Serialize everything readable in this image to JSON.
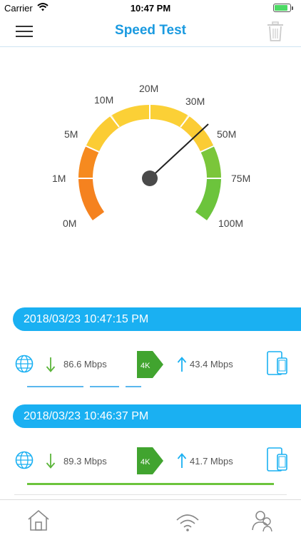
{
  "status_bar": {
    "carrier": "Carrier",
    "time": "10:47 PM",
    "wifi_icon": "wifi-icon",
    "battery_icon": "battery-icon"
  },
  "nav": {
    "title": "Speed Test",
    "menu_icon": "hamburger-icon",
    "trash_icon": "trash-icon"
  },
  "gauge": {
    "labels": [
      "0M",
      "1M",
      "5M",
      "10M",
      "20M",
      "30M",
      "50M",
      "75M",
      "100M"
    ],
    "needle_value": "50M"
  },
  "records": [
    {
      "timestamp": "2018/03/23 10:47:15 PM",
      "download": "86.6 Mbps",
      "upload": "43.4 Mbps",
      "badge": "4K"
    },
    {
      "timestamp": "2018/03/23 10:46:37 PM",
      "download": "89.3 Mbps",
      "upload": "41.7 Mbps",
      "badge": "4K"
    }
  ],
  "colors": {
    "accent": "#1ab0f2",
    "title": "#1a9ae0",
    "orange": "#f5821f",
    "yellow": "#fbd036",
    "green": "#6cc43c",
    "badge_green": "#41a42f"
  },
  "tabs": [
    {
      "icon": "home-icon"
    },
    {
      "icon": "speedometer-icon"
    },
    {
      "icon": "wifi-signal-icon"
    },
    {
      "icon": "users-icon"
    }
  ]
}
